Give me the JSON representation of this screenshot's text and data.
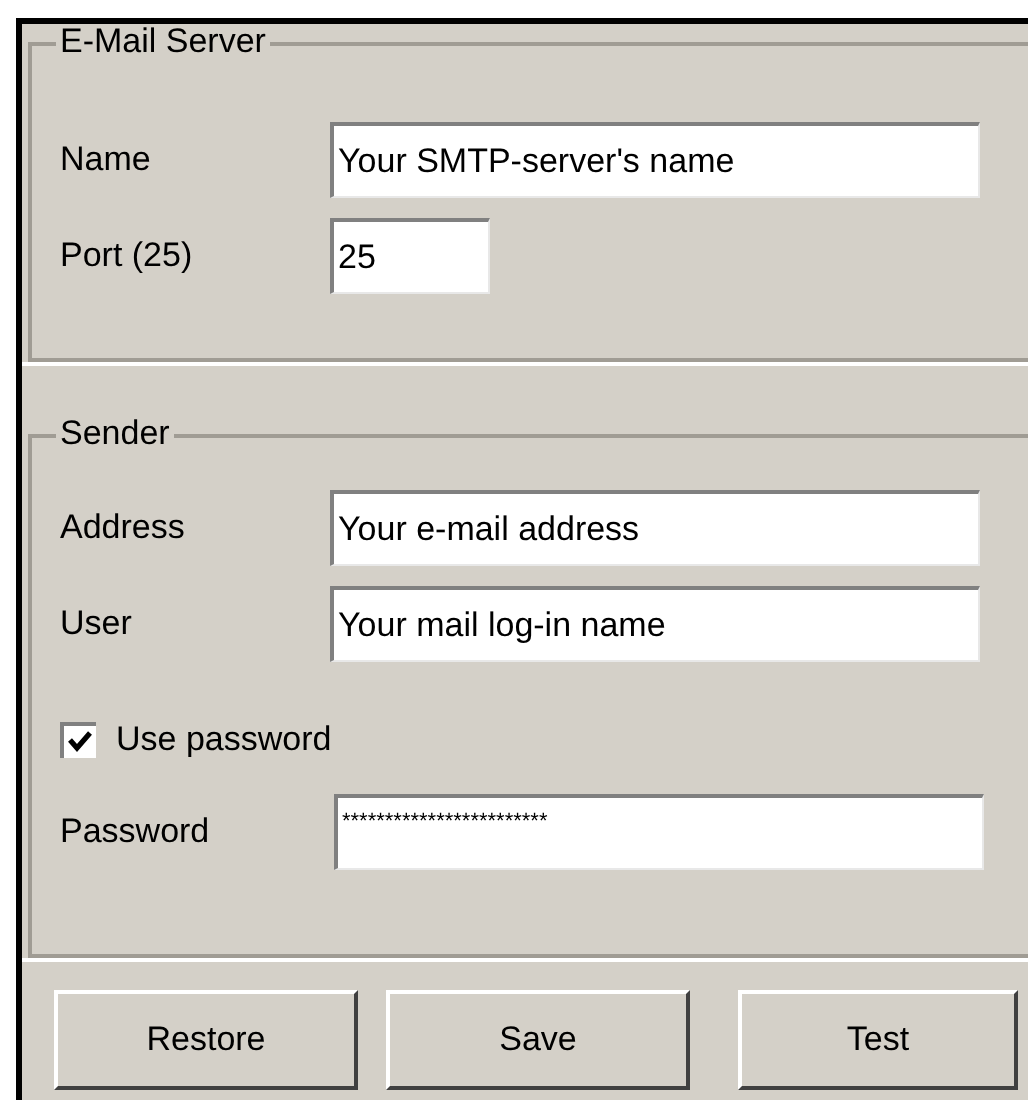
{
  "email_server": {
    "title": "E-Mail Server",
    "fields": [
      {
        "label": "Name",
        "value": "Your SMTP-server's name"
      },
      {
        "label": "Port (25)",
        "value": "25"
      }
    ]
  },
  "sender": {
    "title": "Sender",
    "fields": [
      {
        "label": "Address",
        "value": "Your e-mail address"
      },
      {
        "label": "User",
        "value": "Your mail log-in name"
      }
    ],
    "use_password": {
      "label": "Use password",
      "checked": true
    },
    "password": {
      "label": "Password",
      "value": "************************"
    }
  },
  "buttons": [
    "Restore",
    "Save",
    "Test"
  ]
}
